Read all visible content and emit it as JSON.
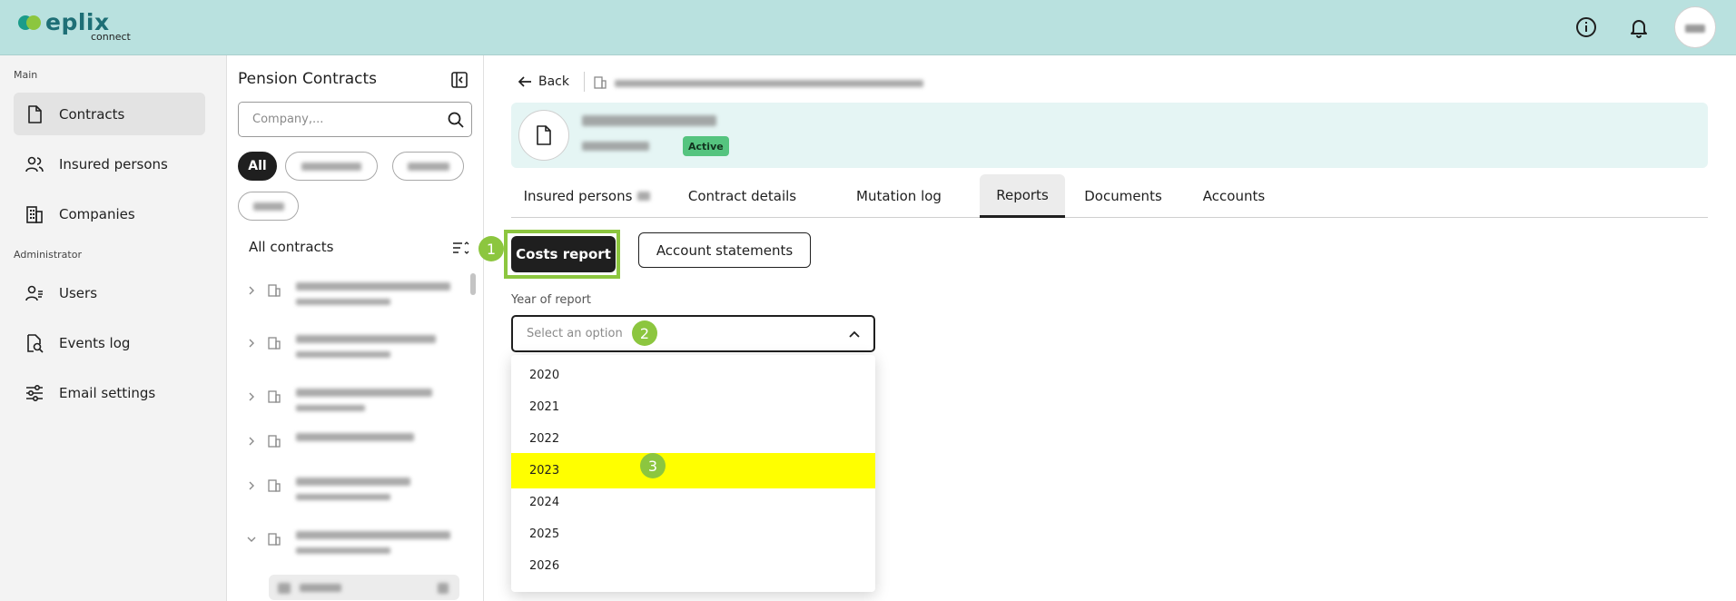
{
  "header": {
    "brand": "eplix",
    "brand_sub": "connect"
  },
  "sidebar": {
    "sections": {
      "main": "Main",
      "administrator": "Administrator"
    },
    "items": [
      {
        "label": "Contracts",
        "icon": "document-icon"
      },
      {
        "label": "Insured persons",
        "icon": "people-icon"
      },
      {
        "label": "Companies",
        "icon": "building-icon"
      },
      {
        "label": "Users",
        "icon": "user-group-icon"
      },
      {
        "label": "Events log",
        "icon": "file-search-icon"
      },
      {
        "label": "Email settings",
        "icon": "sliders-icon"
      }
    ]
  },
  "list": {
    "title": "Pension Contracts",
    "search_placeholder": "Company,...",
    "filter_all": "All",
    "all_contracts": "All contracts"
  },
  "main": {
    "back": "Back",
    "status_badge": "Active",
    "tabs": [
      "Insured persons",
      "Contract details",
      "Mutation log",
      "Reports",
      "Documents",
      "Accounts"
    ],
    "active_tab": "Reports",
    "report_buttons": {
      "costs": "Costs report",
      "accounts": "Account statements"
    },
    "year_field": {
      "label": "Year of report",
      "placeholder": "Select an option"
    },
    "year_options": [
      "2020",
      "2021",
      "2022",
      "2023",
      "2024",
      "2025",
      "2026"
    ],
    "highlighted_option": "2023"
  },
  "annotations": {
    "step1": "1",
    "step2": "2",
    "step3": "3"
  },
  "colors": {
    "header_bg": "#b9e1df",
    "accent_green": "#8cc63f",
    "highlight_yellow": "#ffff00",
    "active_badge": "#55c47f"
  }
}
